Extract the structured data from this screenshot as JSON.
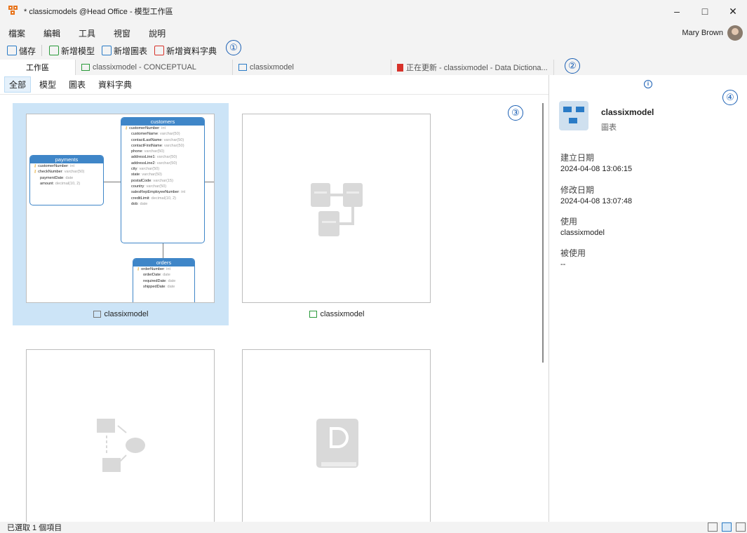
{
  "window": {
    "title": "* classicmodels @Head Office - 模型工作區"
  },
  "menu": [
    {
      "label": "檔案"
    },
    {
      "label": "編輯"
    },
    {
      "label": "工具"
    },
    {
      "label": "視窗"
    },
    {
      "label": "說明"
    }
  ],
  "user": {
    "name": "Mary Brown"
  },
  "toolbar": {
    "save": "儲存",
    "new_model": "新增模型",
    "new_diagram": "新增圖表",
    "new_dictionary": "新增資料字典"
  },
  "callouts": [
    "①",
    "②",
    "③",
    "④"
  ],
  "tabs": [
    {
      "label": "工作區"
    },
    {
      "label": "classixmodel - CONCEPTUAL"
    },
    {
      "label": "classixmodel"
    },
    {
      "label": "正在更新 - classixmodel - Data Dictiona..."
    }
  ],
  "filters": [
    {
      "label": "全部"
    },
    {
      "label": "模型"
    },
    {
      "label": "圖表"
    },
    {
      "label": "資料字典"
    }
  ],
  "cards": [
    {
      "label": "classixmodel"
    },
    {
      "label": "classixmodel"
    }
  ],
  "diagram": {
    "customers": {
      "name": "customers",
      "fields": [
        {
          "name": "customerNumber",
          "type": ": int",
          "key": true
        },
        {
          "name": "customerName",
          "type": ": varchar(50)"
        },
        {
          "name": "contactLastName",
          "type": ": varchar(50)"
        },
        {
          "name": "contactFirstName",
          "type": ": varchar(50)"
        },
        {
          "name": "phone",
          "type": ": varchar(50)"
        },
        {
          "name": "addressLine1",
          "type": ": varchar(50)"
        },
        {
          "name": "addressLine2",
          "type": ": varchar(50)"
        },
        {
          "name": "city",
          "type": ": varchar(50)"
        },
        {
          "name": "state",
          "type": ": varchar(50)"
        },
        {
          "name": "postalCode",
          "type": ": varchar(15)"
        },
        {
          "name": "country",
          "type": ": varchar(50)"
        },
        {
          "name": "salesRepEmployeeNumber",
          "type": ": int"
        },
        {
          "name": "creditLimit",
          "type": ": decimal(10, 2)"
        },
        {
          "name": "dob",
          "type": ": date"
        }
      ]
    },
    "payments": {
      "name": "payments",
      "fields": [
        {
          "name": "customerNumber",
          "type": ": int",
          "key": true
        },
        {
          "name": "checkNumber",
          "type": ": varchar(50)",
          "key": true
        },
        {
          "name": "paymentDate",
          "type": ": date"
        },
        {
          "name": "amount",
          "type": ": decimal(10, 2)"
        }
      ]
    },
    "orders": {
      "name": "orders",
      "fields": [
        {
          "name": "orderNumber",
          "type": ": int",
          "key": true
        },
        {
          "name": "orderDate",
          "type": ": date"
        },
        {
          "name": "requiredDate",
          "type": ": date"
        },
        {
          "name": "shippedDate",
          "type": ": date"
        }
      ]
    }
  },
  "info": {
    "name": "classixmodel",
    "type": "圖表",
    "created_label": "建立日期",
    "created": "2024-04-08 13:06:15",
    "modified_label": "修改日期",
    "modified": "2024-04-08 13:07:48",
    "uses_label": "使用",
    "uses": "classixmodel",
    "used_by_label": "被使用",
    "used_by": "--"
  },
  "status": {
    "text": "已選取 1 個項目"
  },
  "colors": {
    "accent": "#2a7bc6",
    "selection": "#cce4f7",
    "table_header": "#3f86c8",
    "callout": "#1a5fb4"
  }
}
